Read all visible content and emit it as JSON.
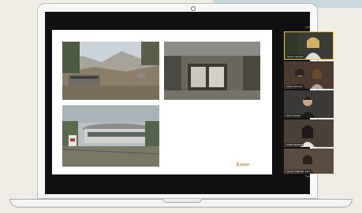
{
  "slide": {
    "logo_text": "Exeter",
    "photos": [
      {
        "name": "hillside-modernist-ruin"
      },
      {
        "name": "stone-pavilion-facade"
      },
      {
        "name": "circular-ring-building"
      }
    ]
  },
  "participants": [
    {
      "name": "Grace Thornton",
      "active": true
    },
    {
      "name": "Libby Friedman",
      "active": false
    },
    {
      "name": "Oliver Nowak",
      "active": false
    },
    {
      "name": "Charla Bradford",
      "active": false
    },
    {
      "name": "Yasmin Catterige-Farm",
      "active": false
    }
  ],
  "controls": {
    "scroll_up": "︿",
    "scroll_down": "﹀"
  },
  "colors": {
    "active_speaker": "#f2c230",
    "logo": "#e06a1f"
  }
}
